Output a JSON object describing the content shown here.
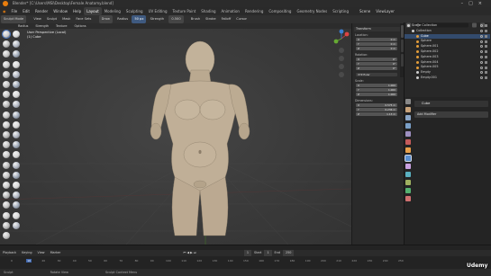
{
  "window": {
    "title": "Blender* [C:\\Users\\MSI\\Desktop\\Female Anatomy.blend]"
  },
  "menu": {
    "items": [
      "File",
      "Edit",
      "Render",
      "Window",
      "Help"
    ],
    "workspaces": [
      "Layout",
      "Modeling",
      "Sculpting",
      "UV Editing",
      "Texture Paint",
      "Shading",
      "Animation",
      "Rendering",
      "Compositing",
      "Geometry Nodes",
      "Scripting"
    ],
    "active_workspace": "Layout",
    "scene_label": "Scene",
    "view_layer_label": "ViewLayer"
  },
  "viewport_header": {
    "mode": "Sculpt Mode",
    "menus": [
      "View",
      "Sculpt",
      "Mask",
      "Face Sets"
    ],
    "tool_settings": [
      "Brush",
      "Stroke",
      "Falloff",
      "Cursor"
    ],
    "options": [
      "Radius",
      "Strength",
      "Texture"
    ],
    "tool_name": "Draw",
    "radius_label": "Radius",
    "radius_value": "50 px",
    "strength_label": "Strength",
    "strength_value": "0.500",
    "overlay_label": "Options"
  },
  "viewport": {
    "view_name": "User Perspective (Local)",
    "object_name": "(1) Cube"
  },
  "n_panel": {
    "section_transform": "Transform",
    "location_label": "Location:",
    "location": [
      {
        "axis": "X",
        "value": "0 m"
      },
      {
        "axis": "Y",
        "value": "0 m"
      },
      {
        "axis": "Z",
        "value": "0 m"
      }
    ],
    "rotation_label": "Rotation:",
    "rotation": [
      {
        "axis": "X",
        "value": "0°"
      },
      {
        "axis": "Y",
        "value": "0°"
      },
      {
        "axis": "Z",
        "value": "0°"
      }
    ],
    "rotation_mode": "XYZ Euler",
    "scale_label": "Scale:",
    "scale": [
      {
        "axis": "X",
        "value": "1.000"
      },
      {
        "axis": "Y",
        "value": "1.000"
      },
      {
        "axis": "Z",
        "value": "1.000"
      }
    ],
    "dimensions_label": "Dimensions:",
    "dimensions": [
      {
        "axis": "X",
        "value": "0.575 m"
      },
      {
        "axis": "Y",
        "value": "0.236 m"
      },
      {
        "axis": "Z",
        "value": "1.13 m"
      }
    ]
  },
  "outliner": {
    "header": "Scene Collection",
    "rows": [
      {
        "label": "Scene Collection",
        "indent": 0,
        "color": "#cfcfcf",
        "selected": false
      },
      {
        "label": "Collection",
        "indent": 1,
        "color": "#cfcfcf",
        "selected": false
      },
      {
        "label": "Cube",
        "indent": 2,
        "color": "#e59e3a",
        "selected": true
      },
      {
        "label": "Sphere",
        "indent": 2,
        "color": "#e59e3a",
        "selected": false
      },
      {
        "label": "Sphere.001",
        "indent": 2,
        "color": "#e59e3a",
        "selected": false
      },
      {
        "label": "Sphere.002",
        "indent": 2,
        "color": "#e59e3a",
        "selected": false
      },
      {
        "label": "Sphere.003",
        "indent": 2,
        "color": "#e59e3a",
        "selected": false
      },
      {
        "label": "Sphere.004",
        "indent": 2,
        "color": "#e59e3a",
        "selected": false
      },
      {
        "label": "Sphere.005",
        "indent": 2,
        "color": "#e59e3a",
        "selected": false
      },
      {
        "label": "Empty",
        "indent": 2,
        "color": "#cfcfcf",
        "selected": false
      },
      {
        "label": "Empty.001",
        "indent": 2,
        "color": "#cfcfcf",
        "selected": false
      }
    ]
  },
  "properties": {
    "object_name": "Cube",
    "add_modifier_label": "Add Modifier"
  },
  "timeline": {
    "menus": [
      "Playback",
      "Keying",
      "View",
      "Marker"
    ],
    "current_frame": "1",
    "start_label": "Start",
    "start_value": "1",
    "end_label": "End",
    "end_value": "250",
    "ruler": [
      "0",
      "10",
      "20",
      "30",
      "40",
      "50",
      "60",
      "70",
      "80",
      "90",
      "100",
      "110",
      "120",
      "130",
      "140",
      "150",
      "160",
      "170",
      "180",
      "190",
      "200",
      "210",
      "220",
      "230",
      "240",
      "250"
    ]
  },
  "statusbar": {
    "left": "Sculpt",
    "middle": "Rotate View",
    "right": "Sculpt Context Menu"
  },
  "watermark": "Udemy"
}
